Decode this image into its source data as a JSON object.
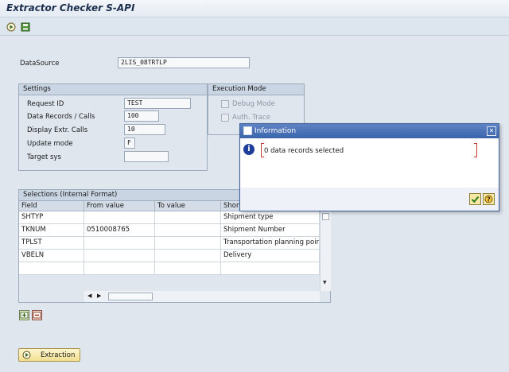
{
  "window": {
    "title": "Extractor Checker S-API"
  },
  "toolbar": {
    "buttons": [
      {
        "icon": "execute-icon"
      },
      {
        "icon": "save-variant-icon"
      }
    ]
  },
  "datasource": {
    "label": "DataSource",
    "value": "2LIS_08TRTLP"
  },
  "settings": {
    "title": "Settings",
    "fields": [
      {
        "label": "Request ID",
        "value": "TEST"
      },
      {
        "label": "Data Records / Calls",
        "value": "100"
      },
      {
        "label": "Display Extr. Calls",
        "value": "10"
      },
      {
        "label": "Update mode",
        "value": "F"
      },
      {
        "label": "Target sys",
        "value": ""
      }
    ]
  },
  "execution_mode": {
    "title": "Execution Mode",
    "options": [
      {
        "label": "Debug Mode"
      },
      {
        "label": "Auth. Trace"
      }
    ]
  },
  "selections": {
    "title": "Selections (Internal Format)",
    "columns": [
      "Field",
      "From value",
      "To value",
      "Short Text"
    ],
    "rows": [
      {
        "field": "SHTYP",
        "from": "",
        "to": "",
        "text": "Shipment type"
      },
      {
        "field": "TKNUM",
        "from": "0510008765",
        "to": "",
        "text": "Shipment Number"
      },
      {
        "field": "TPLST",
        "from": "",
        "to": "",
        "text": "Transportation planning point"
      },
      {
        "field": "VBELN",
        "from": "",
        "to": "",
        "text": "Delivery"
      }
    ]
  },
  "extraction_button": {
    "label": "Extraction"
  },
  "dialog": {
    "title": "Information",
    "message": "0 data records selected"
  },
  "colors": {
    "accent": "#3b63aa",
    "button": "#f1df90",
    "background": "#dfe6ee"
  }
}
